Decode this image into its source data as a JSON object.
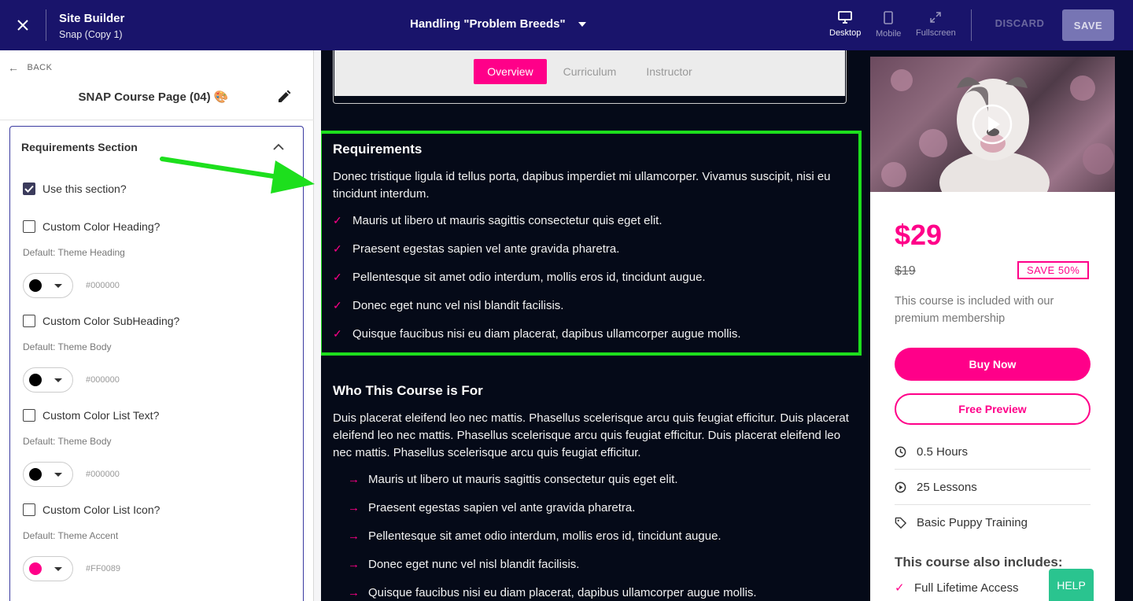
{
  "topbar": {
    "app_name": "Site Builder",
    "site_name": "Snap (Copy 1)",
    "page_selector": "Handling \"Problem Breeds\"",
    "views": {
      "desktop": "Desktop",
      "mobile": "Mobile",
      "fullscreen": "Fullscreen"
    },
    "discard_label": "DISCARD",
    "save_label": "SAVE",
    "bg_color": "#19146b"
  },
  "left_panel": {
    "back_label": "BACK",
    "page_name": "SNAP Course Page (04) 🎨",
    "section": {
      "title": "Requirements Section",
      "use_section_label": "Use this section?",
      "use_section_checked": true,
      "options": [
        {
          "label": "Custom Color Heading?",
          "default": "Default: Theme Heading",
          "color": "#000000",
          "hex": "#000000"
        },
        {
          "label": "Custom Color SubHeading?",
          "default": "Default: Theme Body",
          "color": "#000000",
          "hex": "#000000"
        },
        {
          "label": "Custom Color List Text?",
          "default": "Default: Theme Body",
          "color": "#000000",
          "hex": "#000000"
        },
        {
          "label": "Custom Color List Icon?",
          "default": "Default: Theme Accent",
          "color": "#FF0089",
          "hex": "#FF0089"
        }
      ]
    }
  },
  "preview": {
    "tabs": [
      "Overview",
      "Curriculum",
      "Instructor"
    ],
    "active_tab": "Overview",
    "requirements": {
      "heading": "Requirements",
      "body": "Donec tristique ligula id tellus porta, dapibus imperdiet mi ullamcorper. Vivamus suscipit, nisi eu tincidunt interdum.",
      "items": [
        "Mauris ut libero ut mauris sagittis consectetur quis eget elit.",
        "Praesent egestas sapien vel ante gravida pharetra.",
        "Pellentesque sit amet odio interdum, mollis eros id, tincidunt augue.",
        "Donec eget nunc vel nisl blandit facilisis.",
        "Quisque faucibus nisi eu diam placerat, dapibus ullamcorper augue mollis."
      ]
    },
    "who_for": {
      "heading": "Who This Course is For",
      "body": "Duis placerat eleifend leo nec mattis. Phasellus scelerisque arcu quis feugiat efficitur. Duis placerat eleifend leo nec mattis. Phasellus scelerisque arcu quis feugiat efficitur. Duis placerat eleifend leo nec mattis. Phasellus scelerisque arcu quis feugiat efficitur.",
      "items": [
        "Mauris ut libero ut mauris sagittis consectetur quis eget elit.",
        "Praesent egestas sapien vel ante gravida pharetra.",
        "Pellentesque sit amet odio interdum, mollis eros id, tincidunt augue.",
        "Donec eget nunc vel nisl blandit facilisis.",
        "Quisque faucibus nisi eu diam placerat, dapibus ullamcorper augue mollis."
      ]
    },
    "card": {
      "price": "$29",
      "old_price": "$19",
      "save_badge": "SAVE 50%",
      "included_text": "This course is included with our premium membership",
      "buy_label": "Buy Now",
      "preview_label": "Free Preview",
      "features": [
        "0.5 Hours",
        "25 Lessons",
        "Basic Puppy Training"
      ],
      "also_heading": "This course also includes:",
      "also_items": [
        "Full Lifetime Access"
      ]
    },
    "accent_color": "#FF0089",
    "highlight_color": "#1DDF1D"
  },
  "help_label": "HELP"
}
